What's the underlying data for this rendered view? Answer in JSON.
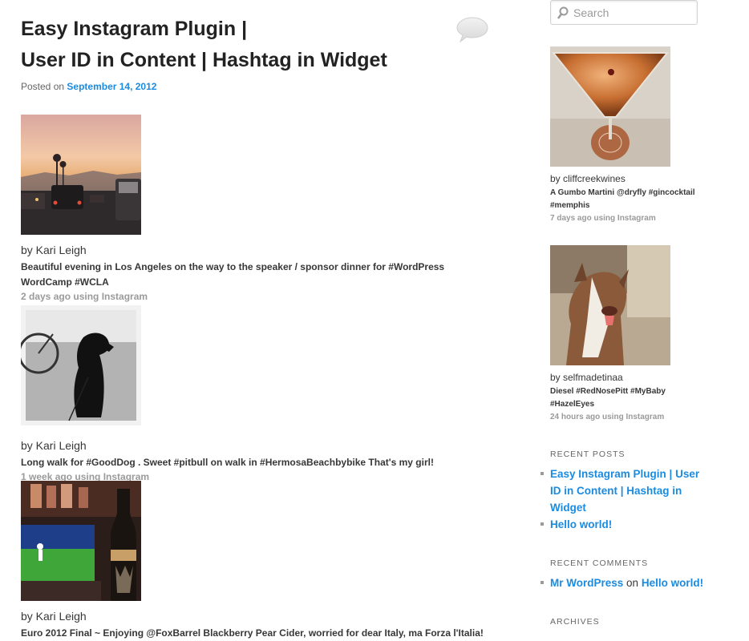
{
  "post": {
    "title_line1": "Easy Instagram Plugin |",
    "title_line2": "User ID in Content | Hashtag in Widget",
    "posted_on": "Posted on",
    "date": "September 14, 2012"
  },
  "feed": [
    {
      "by": "by Kari Leigh",
      "caption": "Beautiful evening in Los Angeles on the way to the speaker / sponsor dinner for #WordPress WordCamp #WCLA",
      "meta": "2 days ago using Instagram"
    },
    {
      "by": "by Kari Leigh",
      "caption": "Long walk for #GoodDog . Sweet #pitbull on walk in #HermosaBeachbybike That's my girl!",
      "meta": "1 week ago using Instagram"
    },
    {
      "by": "by Kari Leigh",
      "caption": "Euro 2012 Final ~ Enjoying @FoxBarrel Blackberry Pear Cider, worried for dear Italy, ma Forza l'Italia!",
      "meta": ""
    }
  ],
  "sidebar": {
    "search_placeholder": "Search",
    "widget_items": [
      {
        "by": "by cliffcreekwines",
        "caption": "A Gumbo Martini @dryfly #gincocktail #memphis",
        "meta": "7 days ago using Instagram"
      },
      {
        "by": "by selfmadetinaa",
        "caption": "Diesel #RedNosePitt #MyBaby #HazelEyes",
        "meta": "24 hours ago using Instagram"
      }
    ],
    "recent_posts_title": "RECENT POSTS",
    "recent_posts": [
      "Easy Instagram Plugin | User ID in Content | Hashtag in Widget",
      "Hello world!"
    ],
    "recent_comments_title": "RECENT COMMENTS",
    "recent_comment": {
      "author": "Mr WordPress",
      "on": "on",
      "post": "Hello world!"
    },
    "archives_title": "ARCHIVES"
  },
  "colors": {
    "link": "#1b8be0",
    "meta_gray": "#9a9a9a",
    "text": "#373737"
  }
}
